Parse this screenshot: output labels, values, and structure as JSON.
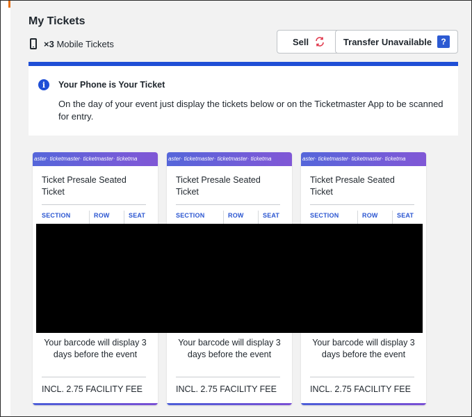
{
  "header": {
    "title": "My Tickets",
    "ticket_count": "×3",
    "ticket_type": "Mobile Tickets",
    "sell_label": "Sell",
    "sell_icon": "refresh-arrows-icon",
    "transfer_label": "Transfer Unavailable",
    "transfer_help_glyph": "?"
  },
  "info": {
    "icon_glyph": "i",
    "title": "Your Phone is Your Ticket",
    "body": "On the day of your event just display the tickets below or on the Ticketmaster App to be scanned for entry."
  },
  "colors": {
    "accent_blue": "#1f4fd6",
    "ticket_band_start": "#4c5ed8",
    "ticket_band_end": "#7a4fd4",
    "sell_icon": "#e0364a",
    "redaction": "#000000"
  },
  "tickets": [
    {
      "band_text": "aster· ticketmaster· ticketmaster· ticketma",
      "name": "Ticket Presale Seated Ticket",
      "col_section": "SECTION",
      "col_row": "ROW",
      "col_seat": "SEAT",
      "barcode_note": "Your barcode will display 3 days before the event",
      "fee": "INCL. 2.75 FACILITY FEE"
    },
    {
      "band_text": "aster· ticketmaster· ticketmaster· ticketma",
      "name": "Ticket Presale Seated Ticket",
      "col_section": "SECTION",
      "col_row": "ROW",
      "col_seat": "SEAT",
      "barcode_note": "Your barcode will display 3 days before the event",
      "fee": "INCL. 2.75 FACILITY FEE"
    },
    {
      "band_text": "aster· ticketmaster· ticketmaster· ticketma",
      "name": "Ticket Presale Seated Ticket",
      "col_section": "SECTION",
      "col_row": "ROW",
      "col_seat": "SEAT",
      "barcode_note": "Your barcode will display 3 days before the event",
      "fee": "INCL. 2.75 FACILITY FEE"
    }
  ]
}
